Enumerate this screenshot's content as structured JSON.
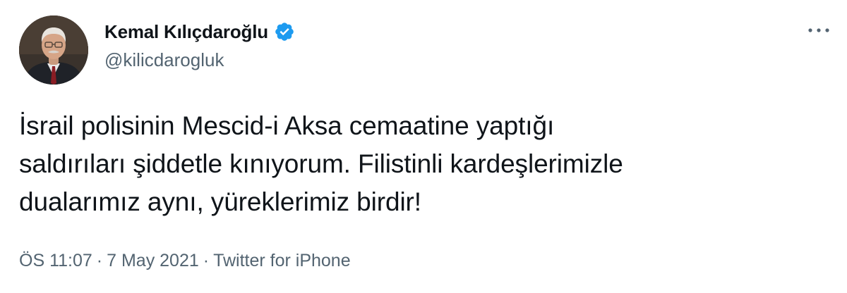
{
  "tweet": {
    "author": {
      "display_name": "Kemal Kılıçdaroğlu",
      "handle": "@kilicdarogluk",
      "verified": true
    },
    "text": "İsrail polisinin Mescid-i Aksa cemaatine yaptığı\nsaldırıları şiddetle kınıyorum. Filistinli kardeşlerimizle\ndualarımız aynı, yüreklerimiz birdir!",
    "time": "ÖS 11:07",
    "separator": "·",
    "date": "7 May 2021",
    "source": "Twitter for iPhone"
  },
  "icons": {
    "verified": "verified-badge-icon",
    "more": "more-options-icon"
  },
  "colors": {
    "text": "#0f1419",
    "secondary": "#536471",
    "verified_blue": "#1d9bf0"
  }
}
